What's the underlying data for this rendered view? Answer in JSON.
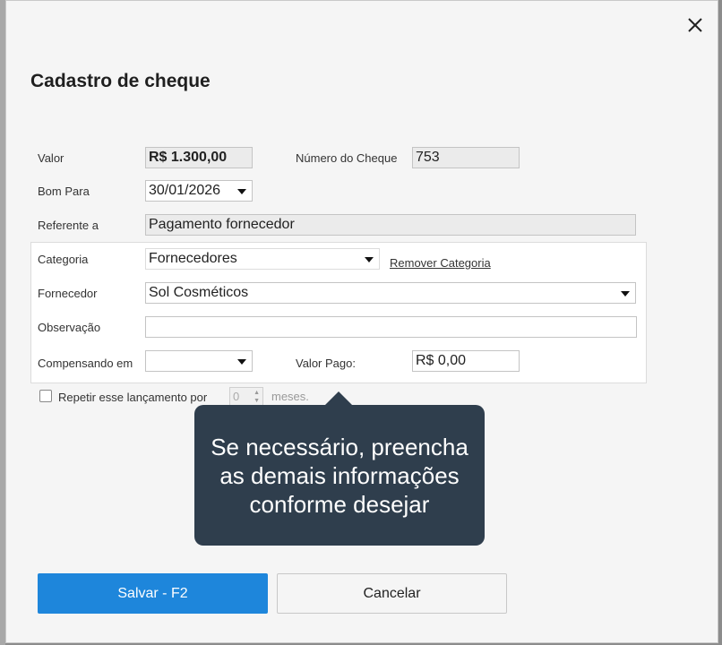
{
  "dialog": {
    "title": "Cadastro de cheque",
    "close_icon": "close-icon"
  },
  "form": {
    "valor_label": "Valor",
    "valor_value": "R$ 1.300,00",
    "numero_label": "Número do Cheque",
    "numero_value": "753",
    "bompara_label": "Bom Para",
    "bompara_value": "30/01/2026",
    "referente_label": "Referente a",
    "referente_value": "Pagamento fornecedor",
    "categoria_label": "Categoria",
    "categoria_value": "Fornecedores",
    "remover_categoria": "Remover Categoria",
    "fornecedor_label": "Fornecedor",
    "fornecedor_value": "Sol Cosméticos",
    "observacao_label": "Observação",
    "observacao_value": "",
    "compensando_label": "Compensando em",
    "compensando_value": "",
    "valorpago_label": "Valor Pago:",
    "valorpago_value": "R$ 0,00",
    "repetir_label": "Repetir esse lançamento por",
    "repetir_value": "0",
    "meses_label": "meses."
  },
  "tooltip": {
    "text": "Se necessário, preencha as demais informações conforme desejar"
  },
  "buttons": {
    "save": "Salvar - F2",
    "cancel": "Cancelar"
  },
  "colors": {
    "primary": "#1e86db",
    "tooltip_bg": "#2f3e4d"
  }
}
